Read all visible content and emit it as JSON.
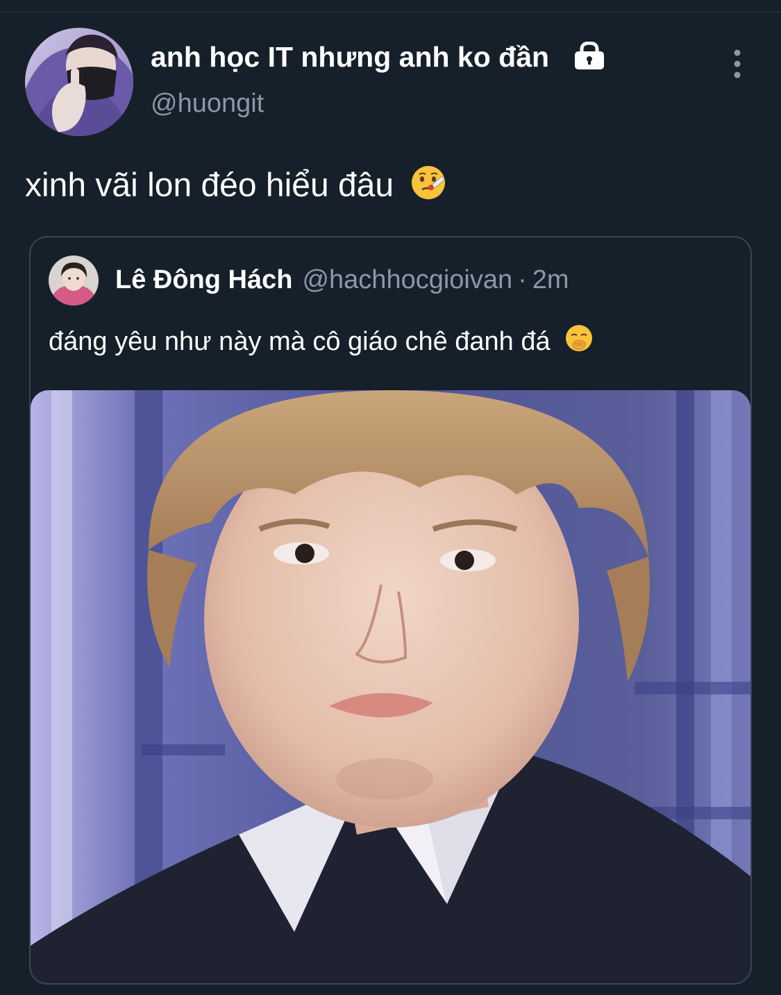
{
  "tweet": {
    "author": {
      "display_name": "anh học IT nhưng anh ko đần",
      "handle": "@huongit",
      "protected_icon": "lock-icon"
    },
    "more_icon": "more-vertical-icon",
    "text": "xinh vãi lon đéo hiểu đâu",
    "emoji": "face-with-thermometer"
  },
  "quote": {
    "author": {
      "display_name": "Lê Đông Hách",
      "handle": "@hachhocgioivan",
      "separator": "·",
      "time": "2m"
    },
    "text": "đáng yêu như này mà cô giáo chê đanh đá",
    "emoji": "face-with-hand-over-mouth",
    "media": "photo"
  },
  "colors": {
    "background": "#16202a",
    "primary_text": "#ffffff",
    "secondary_text": "#8b98a5",
    "border": "#3a4652"
  }
}
